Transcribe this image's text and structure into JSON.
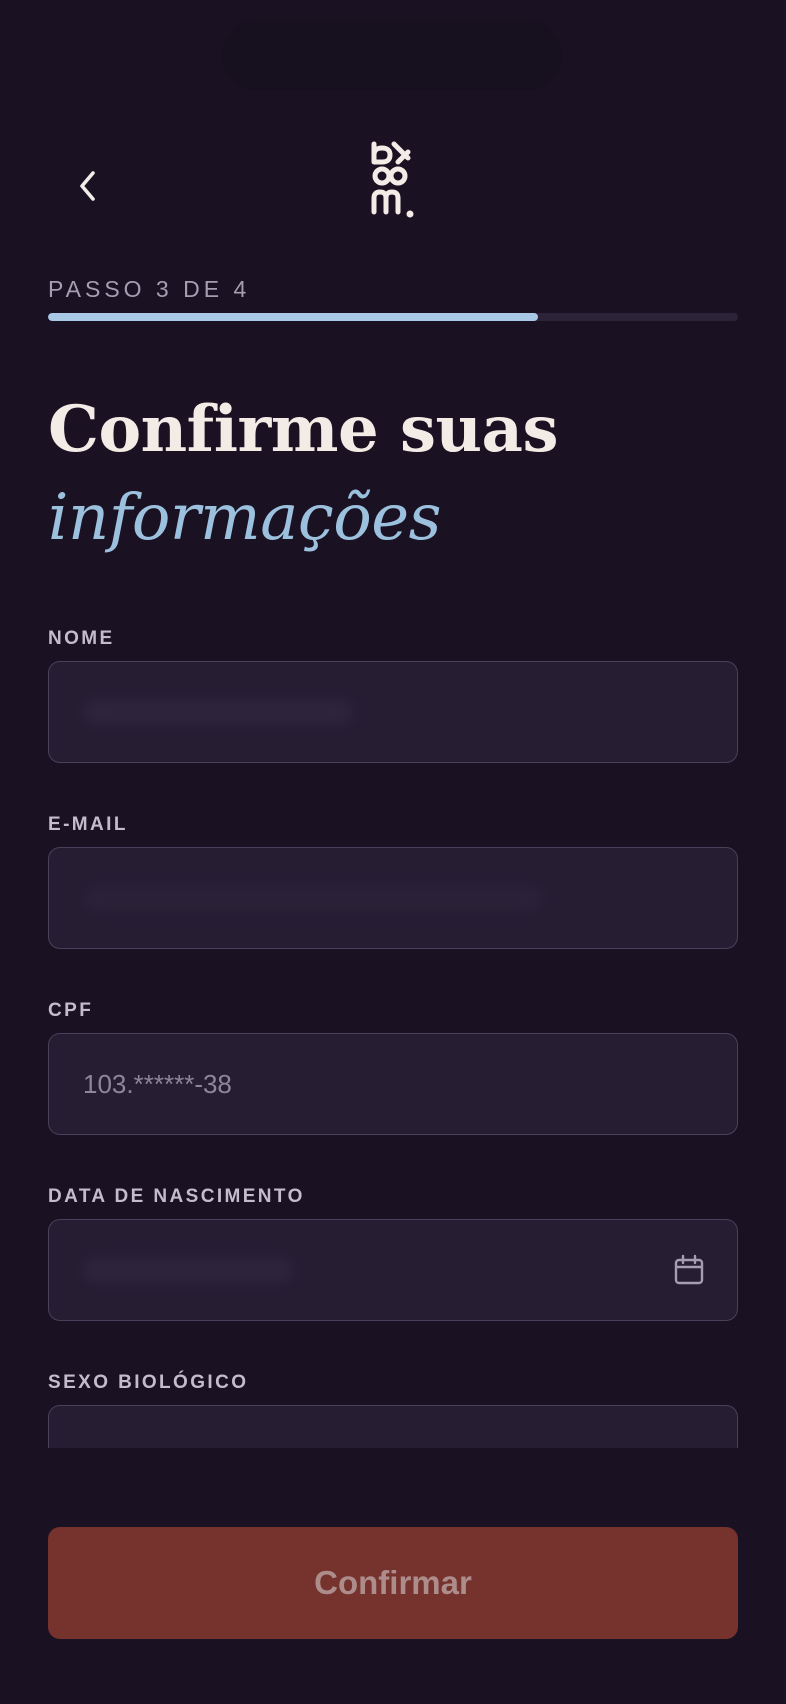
{
  "header": {
    "back_icon": "chevron-left-icon",
    "logo_icon": "bloom-logo"
  },
  "progress": {
    "step_label": "PASSO 3 DE 4",
    "fraction": 0.71
  },
  "title": {
    "line1": "Confirme suas",
    "line2": "informações"
  },
  "form": {
    "name": {
      "label": "NOME",
      "value": ""
    },
    "email": {
      "label": "E-MAIL",
      "value": ""
    },
    "cpf": {
      "label": "CPF",
      "value": "103.******-38"
    },
    "birthdate": {
      "label": "DATA DE NASCIMENTO",
      "value": "",
      "icon": "calendar-icon"
    },
    "sex": {
      "label": "SEXO BIOLÓGICO",
      "icon": "chevron-down-icon"
    }
  },
  "actions": {
    "confirm_label": "Confirmar"
  },
  "colors": {
    "background": "#1a1223",
    "accent_blue": "#9cc1de",
    "button": "#76322c"
  }
}
